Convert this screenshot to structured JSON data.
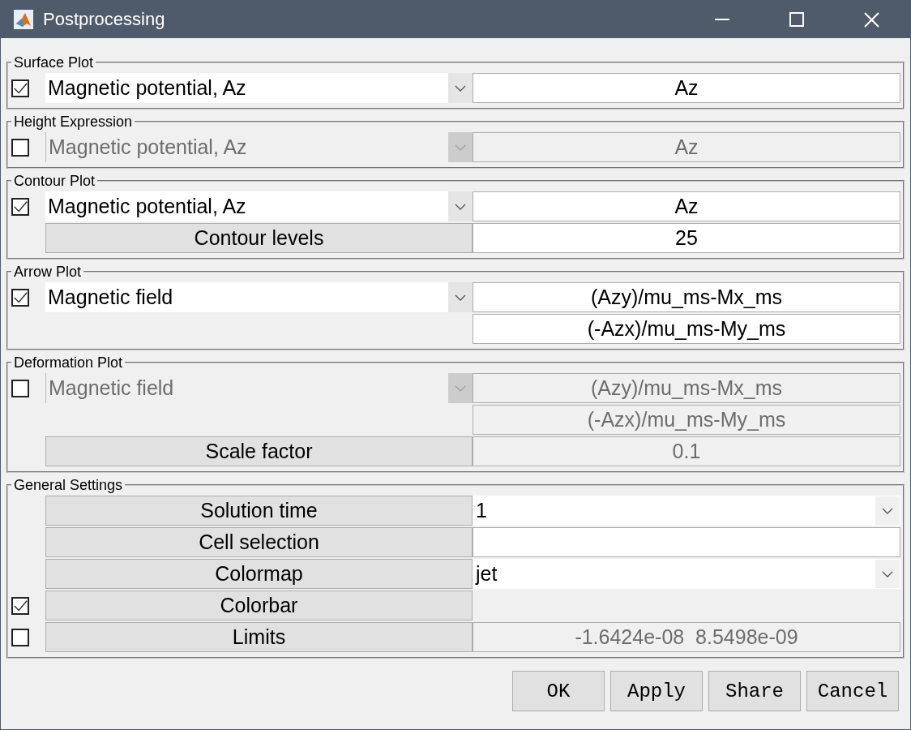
{
  "window": {
    "title": "Postprocessing"
  },
  "sections": [
    {
      "title": "Surface Plot",
      "rows": [
        {
          "checked": true,
          "left": {
            "kind": "select",
            "text": "Magnetic potential, Az",
            "disabled": false
          },
          "right": {
            "kind": "field",
            "value": "Az",
            "disabled": false
          }
        }
      ]
    },
    {
      "title": "Height Expression",
      "rows": [
        {
          "checked": false,
          "left": {
            "kind": "select",
            "text": "Magnetic potential, Az",
            "disabled": true
          },
          "right": {
            "kind": "field",
            "value": "Az",
            "disabled": true
          }
        }
      ]
    },
    {
      "title": "Contour Plot",
      "rows": [
        {
          "checked": true,
          "left": {
            "kind": "select",
            "text": "Magnetic potential, Az",
            "disabled": false
          },
          "right": {
            "kind": "field",
            "value": "Az",
            "disabled": false
          }
        },
        {
          "left": {
            "kind": "label",
            "text": "Contour levels"
          },
          "right": {
            "kind": "field",
            "value": "25",
            "disabled": false
          }
        }
      ]
    },
    {
      "title": "Arrow Plot",
      "rows": [
        {
          "checked": true,
          "left": {
            "kind": "select",
            "text": "Magnetic field",
            "disabled": false
          },
          "right": {
            "kind": "field",
            "value": "(Azy)/mu_ms-Mx_ms",
            "disabled": false
          }
        },
        {
          "right": {
            "kind": "field",
            "value": "(-Azx)/mu_ms-My_ms",
            "disabled": false
          }
        }
      ]
    },
    {
      "title": "Deformation Plot",
      "rows": [
        {
          "checked": false,
          "left": {
            "kind": "select",
            "text": "Magnetic field",
            "disabled": true
          },
          "right": {
            "kind": "field",
            "value": "(Azy)/mu_ms-Mx_ms",
            "disabled": true
          }
        },
        {
          "right": {
            "kind": "field",
            "value": "(-Azx)/mu_ms-My_ms",
            "disabled": true
          }
        },
        {
          "left": {
            "kind": "label",
            "text": "Scale factor"
          },
          "right": {
            "kind": "field",
            "value": "0.1",
            "disabled": true
          }
        }
      ]
    },
    {
      "title": "General Settings",
      "rows": [
        {
          "left": {
            "kind": "label",
            "text": "Solution time"
          },
          "right": {
            "kind": "select",
            "value": "1",
            "disabled": false
          }
        },
        {
          "left": {
            "kind": "label",
            "text": "Cell selection"
          },
          "right": {
            "kind": "field",
            "disabled": false
          }
        },
        {
          "left": {
            "kind": "label",
            "text": "Colormap"
          },
          "right": {
            "kind": "select",
            "value": "jet",
            "disabled": false
          }
        },
        {
          "checked": true,
          "left": {
            "kind": "label",
            "text": "Colorbar"
          }
        },
        {
          "checked": false,
          "left": {
            "kind": "label",
            "text": "Limits"
          },
          "right": {
            "kind": "field",
            "value": "-1.6424e-08  8.5498e-09",
            "disabled": true
          }
        }
      ]
    }
  ],
  "buttons": [
    "OK",
    "Apply",
    "Share",
    "Cancel"
  ]
}
